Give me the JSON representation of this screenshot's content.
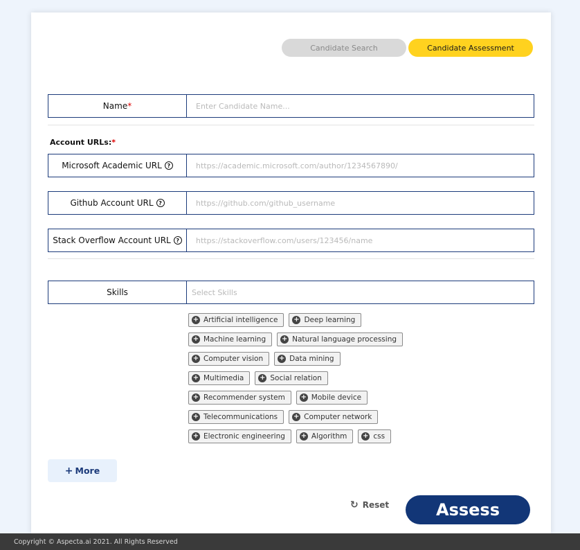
{
  "tabs": {
    "search_label": "Candidate Search",
    "assessment_label": "Candidate Assessment"
  },
  "name_field": {
    "label": "Name",
    "required_mark": "*",
    "placeholder": "Enter Candidate Name..."
  },
  "account_urls": {
    "label": "Account URLs:",
    "required_mark": "*",
    "microsoft": {
      "label": "Microsoft Academic URL",
      "placeholder": "https://academic.microsoft.com/author/1234567890/"
    },
    "github": {
      "label": "Github Account URL",
      "placeholder": "https://github.com/github_username"
    },
    "stackoverflow": {
      "label": "Stack Overflow Account URL",
      "placeholder": "https://stackoverflow.com/users/123456/name"
    }
  },
  "skills": {
    "label": "Skills",
    "placeholder": "Select Skills",
    "suggestions": [
      [
        "Artificial intelligence",
        "Deep learning"
      ],
      [
        "Machine learning",
        "Natural language processing"
      ],
      [
        "Computer vision",
        "Data mining"
      ],
      [
        "Multimedia",
        "Social relation"
      ],
      [
        "Recommender system",
        "Mobile device"
      ],
      [
        "Telecommunications",
        "Computer network"
      ],
      [
        "Electronic engineering",
        "Algorithm",
        "css"
      ]
    ]
  },
  "actions": {
    "more_label": "More",
    "reset_label": "Reset",
    "assess_label": "Assess"
  },
  "footer": {
    "copyright": "Copyright © Aspecta.ai 2021. All Rights Reserved"
  },
  "colors": {
    "accent_navy": "#123677",
    "accent_yellow": "#ffd21f",
    "required_red": "#dd0000"
  },
  "icons": {
    "help": "question-circle-icon",
    "chip_add": "plus-circle-icon",
    "reset": "refresh-icon",
    "more": "plus-icon"
  }
}
